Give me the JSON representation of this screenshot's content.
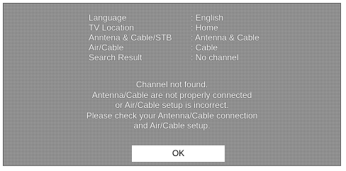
{
  "info_rows": [
    {
      "label": "Language",
      "value": ": English"
    },
    {
      "label": "TV Location",
      "value": ": Home"
    },
    {
      "label": "Anntena & Cable/STB",
      "value": ": Antenna & Cable"
    },
    {
      "label": "Air/Cable",
      "value": ": Cable"
    },
    {
      "label": "Search Result",
      "value": ": No channel"
    }
  ],
  "message_lines": [
    "Channel not found.",
    "Antenna/Cable are not properly connected",
    "or Air/Cable setup is incorrect.",
    "Please check your Antenna/Cable connection",
    "and Air/Cable setup."
  ],
  "ok_button": {
    "label": "OK"
  }
}
